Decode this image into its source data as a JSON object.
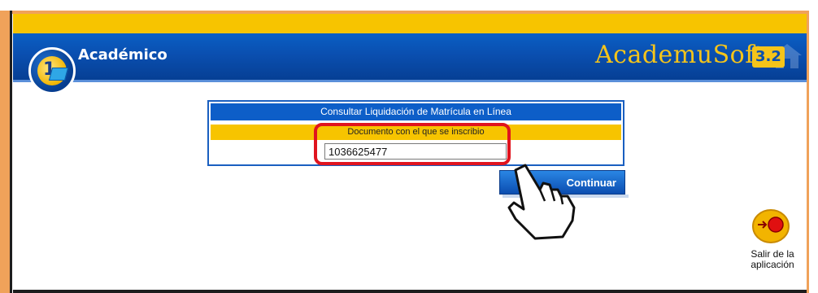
{
  "header": {
    "title": "Académico",
    "brand": "AcademuSoft",
    "version": "3.2"
  },
  "form": {
    "title": "Consultar Liquidación de Matrícula en Línea",
    "field_label": "Documento con el que se inscribio",
    "document_value": "1036625477"
  },
  "actions": {
    "continue_label": "Continuar"
  },
  "exit": {
    "line1": "Salir de la",
    "line2": "aplicación"
  },
  "colors": {
    "header_blue": "#0a4fb0",
    "accent_yellow": "#f7c400",
    "frame_orange": "#f0a25a",
    "highlight_red": "#e0141e"
  },
  "icons": {
    "logo": "academic-logo-icon",
    "cursor": "hand-pointer-icon",
    "exit": "exit-button-icon"
  }
}
